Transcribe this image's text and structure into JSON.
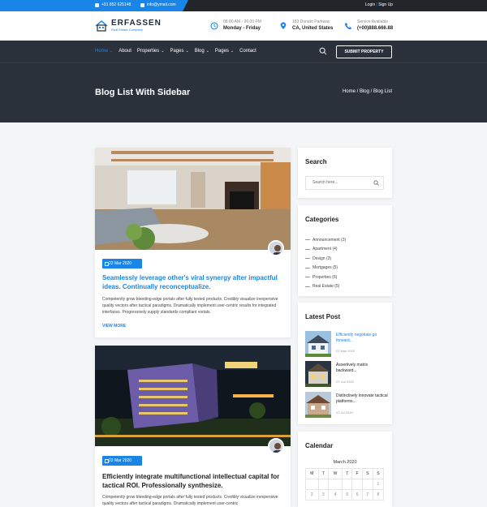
{
  "topbar": {
    "phone": "+91 852 625148",
    "email": "info@ymail.com",
    "login": "Login",
    "separator": " | ",
    "signup": "Sign Up"
  },
  "header": {
    "logo_name": "ERFASSEN",
    "logo_tagline": "Real Estate Company",
    "hours_line1": "08:00 AM - 06:00 PM",
    "hours_line2": "Monday - Friday",
    "address_line1": "183 Donato Parkway",
    "address_line2": "CA, United States",
    "service_line1": "Service Available",
    "service_line2": "(+00)888.666.88"
  },
  "nav": {
    "items": [
      {
        "label": "Home",
        "caret": true
      },
      {
        "label": "About",
        "caret": false
      },
      {
        "label": "Properties",
        "caret": true
      },
      {
        "label": "Pages",
        "caret": true
      },
      {
        "label": "Blog",
        "caret": true
      },
      {
        "label": "Pages",
        "caret": true
      },
      {
        "label": "Contact",
        "caret": false
      }
    ],
    "submit_label": "SUBMIT PROPERTY"
  },
  "hero": {
    "title": "Blog List With Sidebar",
    "breadcrumb": "Home / Blog / Blog List"
  },
  "posts": [
    {
      "date": "22 Mar 2020",
      "title": "Seamlessly leverage other's viral synergy after impactful ideas. Continually reconceptualize.",
      "text": "Competently grow bleeding-edge portals after fully tested products. Credibly visualize inexpensive quality vectors after tactical paradigms. Dramatically implement user-centric results for integrated interfaces. Progressively supply standards compliant vortals.",
      "more": "VIEW MORE"
    },
    {
      "date": "22 Mar 2020",
      "title": "Efficiently integrate multifunctional intellectual capital for tactical ROI. Professionally synthesize.",
      "text": "Competently grow bleeding-edge portals after fully tested products. Credibly visualize inexpensive quality vectors after tactical paradigms. Dramatically implement user-centric"
    }
  ],
  "sidebar": {
    "search_title": "Search",
    "search_placeholder": "Search here...",
    "categories_title": "Categories",
    "categories": [
      "Announcement (3)",
      "Apartment (4)",
      "Design (3)",
      "Mortgages (5)",
      "Properties (6)",
      "Real Estate (5)"
    ],
    "latest_title": "Latest Post",
    "latest": [
      {
        "title": "Efficiently negotiate go forward...",
        "date": "07 May 2020"
      },
      {
        "title": "Assertively matrix backward...",
        "date": "07 Jun 2020"
      },
      {
        "title": "Distinctively innovate tactical platforms...",
        "date": "07 Jul 2020"
      }
    ],
    "calendar_title": "Calendar",
    "calendar_month": "March 2020",
    "calendar_days": [
      "M",
      "T",
      "W",
      "T",
      "F",
      "S",
      "S"
    ],
    "calendar_rows": [
      [
        "",
        "",
        "",
        "",
        "",
        "",
        "1"
      ],
      [
        "2",
        "3",
        "4",
        "5",
        "6",
        "7",
        "8"
      ]
    ]
  },
  "colors": {
    "accent": "#1a85e8",
    "dark": "#2b313b"
  }
}
